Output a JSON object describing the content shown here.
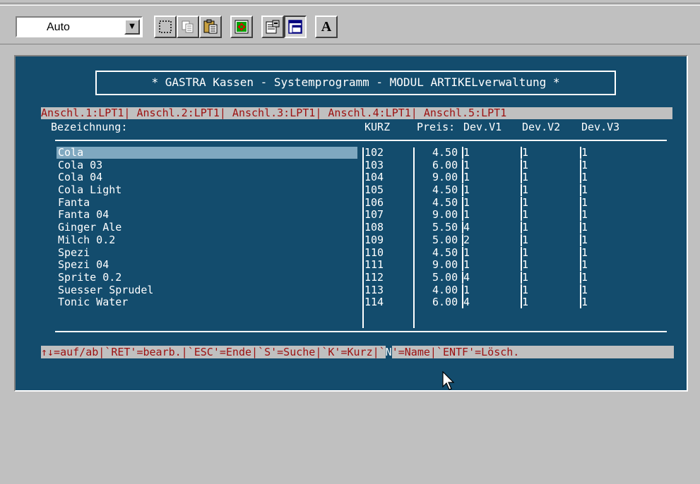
{
  "toolbar": {
    "font_select_value": "Auto",
    "buttons": [
      "mark-icon",
      "copy-icon",
      "paste-icon",
      "fullscreen-icon",
      "properties-icon",
      "background-icon",
      "font-icon"
    ],
    "font_button_label": "A"
  },
  "console": {
    "title": "* GASTRA Kassen - Systemprogramm - MODUL ARTIKELverwaltung *",
    "ports_line": "Anschl.1:LPT1| Anschl.2:LPT1| Anschl.3:LPT1| Anschl.4:LPT1| Anschl.5:LPT1",
    "headers": {
      "bezeichnung": "Bezeichnung:",
      "kurz": "KURZ",
      "preis": "Preis:",
      "dev1": "Dev.V1",
      "dev2": "Dev.V2",
      "dev3": "Dev.V3"
    },
    "rows": [
      {
        "name": "Cola",
        "kurz": "102",
        "preis": "4.50",
        "d1": "1",
        "d2": "1",
        "d3": "1"
      },
      {
        "name": "Cola 03",
        "kurz": "103",
        "preis": "6.00",
        "d1": "1",
        "d2": "1",
        "d3": "1"
      },
      {
        "name": "Cola 04",
        "kurz": "104",
        "preis": "9.00",
        "d1": "1",
        "d2": "1",
        "d3": "1"
      },
      {
        "name": "Cola Light",
        "kurz": "105",
        "preis": "4.50",
        "d1": "1",
        "d2": "1",
        "d3": "1"
      },
      {
        "name": "Fanta",
        "kurz": "106",
        "preis": "4.50",
        "d1": "1",
        "d2": "1",
        "d3": "1"
      },
      {
        "name": "Fanta 04",
        "kurz": "107",
        "preis": "9.00",
        "d1": "1",
        "d2": "1",
        "d3": "1"
      },
      {
        "name": "Ginger Ale",
        "kurz": "108",
        "preis": "5.50",
        "d1": "4",
        "d2": "1",
        "d3": "1"
      },
      {
        "name": "Milch 0.2",
        "kurz": "109",
        "preis": "5.00",
        "d1": "2",
        "d2": "1",
        "d3": "1"
      },
      {
        "name": "Spezi",
        "kurz": "110",
        "preis": "4.50",
        "d1": "1",
        "d2": "1",
        "d3": "1"
      },
      {
        "name": "Spezi 04",
        "kurz": "111",
        "preis": "9.00",
        "d1": "1",
        "d2": "1",
        "d3": "1"
      },
      {
        "name": "Sprite 0.2",
        "kurz": "112",
        "preis": "5.00",
        "d1": "4",
        "d2": "1",
        "d3": "1"
      },
      {
        "name": "Suesser Sprudel",
        "kurz": "113",
        "preis": "4.00",
        "d1": "1",
        "d2": "1",
        "d3": "1"
      },
      {
        "name": "Tonic Water",
        "kurz": "114",
        "preis": "6.00",
        "d1": "4",
        "d2": "1",
        "d3": "1"
      }
    ],
    "selected_row": 0,
    "status": {
      "part1": "↑↓=auf/ab|`RET'=bearb.|`ESC'=Ende|`S'=Suche|`K'=Kurz|`",
      "highlight": "N",
      "part2": "'=Name|`ENTF'=Lösch."
    }
  },
  "colors": {
    "console_bg": "#134c6d",
    "selection_bg": "#7fa8c0",
    "hotkey_text": "#9c1010",
    "window_face": "#c0c0c0"
  }
}
